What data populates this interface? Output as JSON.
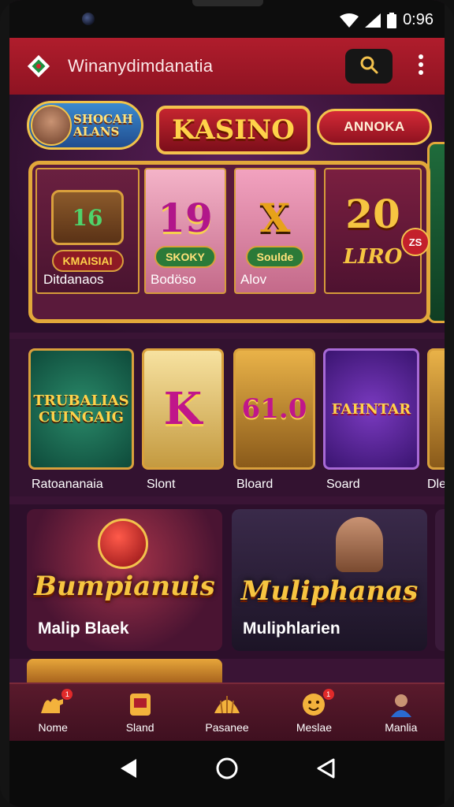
{
  "status_bar": {
    "time": "0:96"
  },
  "app_bar": {
    "title": "Winanydimdanatia",
    "search_icon": "search-icon",
    "more_icon": "more-vertical-icon"
  },
  "hero": {
    "promo_badge": "SHOCAH ALANS",
    "banner_title": "KASINO",
    "action_button": "ANNOKA",
    "corner_badge": "ZS",
    "cards": [
      {
        "big": "16",
        "pill": "KMAISIAI",
        "label": "Ditdanaos"
      },
      {
        "big": "19",
        "pill": "SKOKY",
        "label": "Bodöso"
      },
      {
        "big": "X",
        "pill": "Soulde",
        "label": "Alov"
      },
      {
        "big": "20",
        "pill": "LIRO",
        "label": ""
      }
    ]
  },
  "games": [
    {
      "art": "TRUBALIAS CUINGAIG",
      "label": "Ratoananaia"
    },
    {
      "art": "K",
      "label": "Slont"
    },
    {
      "art": "61.0",
      "label": "Bloard"
    },
    {
      "art": "FAHNTAR",
      "label": "Soard"
    },
    {
      "art": "",
      "label": "Dle"
    }
  ],
  "featured": [
    {
      "art": "Bumpianuis",
      "title": "Malip Blaek"
    },
    {
      "art": "Muliphanas",
      "title": "Muliphlarien"
    }
  ],
  "bottom_nav": [
    {
      "label": "Nome",
      "icon": "camel-icon",
      "badge": "1"
    },
    {
      "label": "Sland",
      "icon": "slot-icon",
      "badge": ""
    },
    {
      "label": "Pasanee",
      "icon": "shell-icon",
      "badge": ""
    },
    {
      "label": "Meslae",
      "icon": "face-icon",
      "badge": "1"
    },
    {
      "label": "Manlia",
      "icon": "player-icon",
      "badge": ""
    }
  ],
  "colors": {
    "header": "#b01d2c",
    "background": "#3a1435",
    "gold": "#e2a83a"
  }
}
